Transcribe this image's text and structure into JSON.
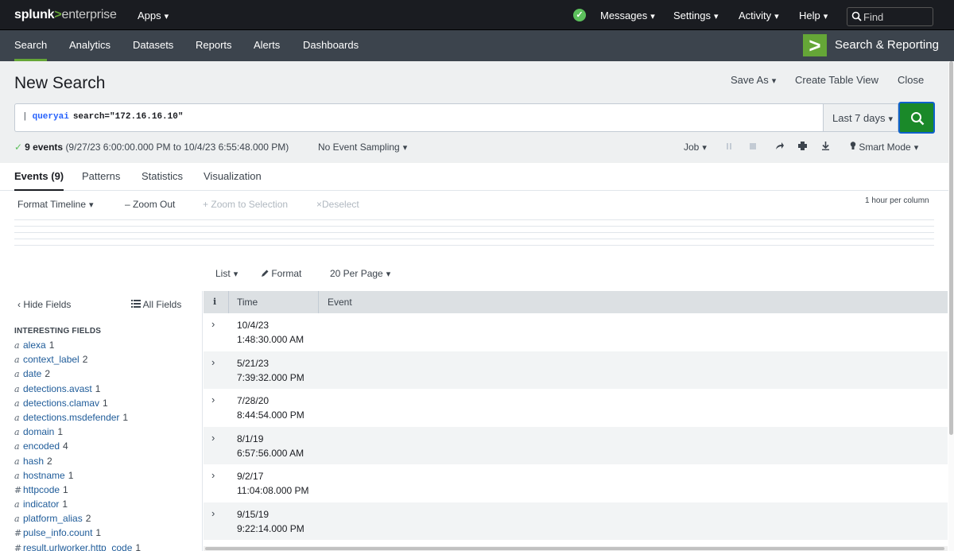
{
  "topbar": {
    "logo_part1": "splunk",
    "logo_gt": ">",
    "logo_part2": "enterprise",
    "apps_label": "Apps",
    "messages_label": "Messages",
    "settings_label": "Settings",
    "activity_label": "Activity",
    "help_label": "Help",
    "find_placeholder": "Find",
    "status_color": "#5cc05c"
  },
  "appbar": {
    "nav": [
      "Search",
      "Analytics",
      "Datasets",
      "Reports",
      "Alerts",
      "Dashboards"
    ],
    "active": "Search",
    "app_title": "Search & Reporting",
    "app_logo_glyph": ">",
    "accent_color": "#65a637"
  },
  "header": {
    "title": "New Search",
    "save_as": "Save As",
    "create_table_view": "Create Table View",
    "close": "Close"
  },
  "search": {
    "pipe": "|",
    "command": "queryai",
    "argument": "search=\"172.16.16.10\"",
    "time_range": "Last 7 days",
    "button_icon": "search-icon",
    "button_color": "#1a8929"
  },
  "status": {
    "check": "✓",
    "events_bold": "9 events",
    "range_text": "(9/27/23 6:00:00.000 PM to 10/4/23 6:55:48.000 PM)",
    "sampling": "No Event Sampling",
    "job": "Job",
    "smart_mode": "Smart Mode"
  },
  "tabs": [
    "Events (9)",
    "Patterns",
    "Statistics",
    "Visualization"
  ],
  "timeline": {
    "format": "Format Timeline",
    "zoom_out": "Zoom Out",
    "zoom_selection": "Zoom to Selection",
    "deselect": "Deselect",
    "per_column": "1 hour per column"
  },
  "listctl": {
    "list": "List",
    "format": "Format",
    "per_page": "20 Per Page"
  },
  "sidebar": {
    "hide_fields": "Hide Fields",
    "all_fields": "All Fields",
    "heading": "INTERESTING FIELDS",
    "fields": [
      {
        "type": "a",
        "name": "alexa",
        "count": "1"
      },
      {
        "type": "a",
        "name": "context_label",
        "count": "2"
      },
      {
        "type": "a",
        "name": "date",
        "count": "2"
      },
      {
        "type": "a",
        "name": "detections.avast",
        "count": "1"
      },
      {
        "type": "a",
        "name": "detections.clamav",
        "count": "1"
      },
      {
        "type": "a",
        "name": "detections.msdefender",
        "count": "1"
      },
      {
        "type": "a",
        "name": "domain",
        "count": "1"
      },
      {
        "type": "a",
        "name": "encoded",
        "count": "4"
      },
      {
        "type": "a",
        "name": "hash",
        "count": "2"
      },
      {
        "type": "a",
        "name": "hostname",
        "count": "1"
      },
      {
        "type": "#",
        "name": "httpcode",
        "count": "1"
      },
      {
        "type": "a",
        "name": "indicator",
        "count": "1"
      },
      {
        "type": "a",
        "name": "platform_alias",
        "count": "2"
      },
      {
        "type": "#",
        "name": "pulse_info.count",
        "count": "1"
      },
      {
        "type": "#",
        "name": "result.urlworker.http_code",
        "count": "1"
      }
    ]
  },
  "events": {
    "col_info": "i",
    "col_time": "Time",
    "col_event": "Event",
    "rows": [
      {
        "date": "10/4/23",
        "time": "1:48:30.000 AM"
      },
      {
        "date": "5/21/23",
        "time": "7:39:32.000 PM"
      },
      {
        "date": "7/28/20",
        "time": "8:44:54.000 PM"
      },
      {
        "date": "8/1/19",
        "time": "6:57:56.000 AM"
      },
      {
        "date": "9/2/17",
        "time": "11:04:08.000 PM"
      },
      {
        "date": "9/15/19",
        "time": "9:22:14.000 PM"
      }
    ]
  }
}
